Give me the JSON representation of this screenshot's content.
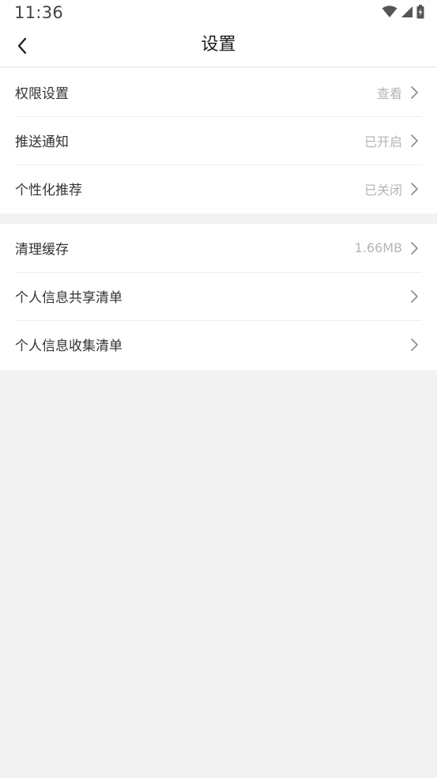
{
  "status_bar": {
    "time": "11:36",
    "icons": [
      "wifi-icon",
      "signal-icon",
      "battery-charging-icon"
    ]
  },
  "header": {
    "title": "设置",
    "back_icon": "chevron-left-icon"
  },
  "sections": [
    {
      "items": [
        {
          "label": "权限设置",
          "value": "查看"
        },
        {
          "label": "推送通知",
          "value": "已开启"
        },
        {
          "label": "个性化推荐",
          "value": "已关闭"
        }
      ]
    },
    {
      "items": [
        {
          "label": "清理缓存",
          "value": "1.66MB"
        },
        {
          "label": "个人信息共享清单",
          "value": ""
        },
        {
          "label": "个人信息收集清单",
          "value": ""
        }
      ]
    }
  ],
  "colors": {
    "background": "#f2f2f2",
    "card": "#ffffff",
    "text_primary": "#333333",
    "text_secondary": "#b5b5b5",
    "divider": "#ededed"
  }
}
